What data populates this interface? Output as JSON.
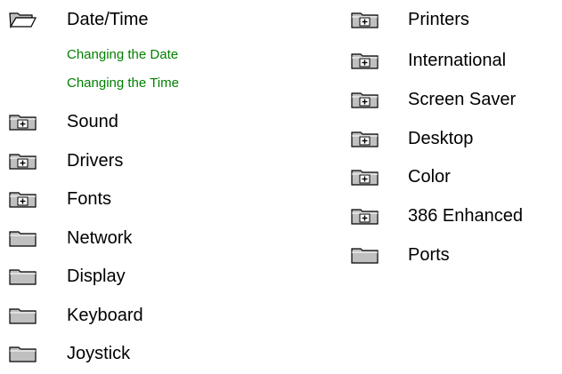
{
  "left_column": {
    "items": [
      {
        "label": "Date/Time",
        "icon": "open-folder-icon"
      },
      {
        "label": "Sound",
        "icon": "folder-plus-icon"
      },
      {
        "label": "Drivers",
        "icon": "folder-plus-icon"
      },
      {
        "label": "Fonts",
        "icon": "folder-plus-icon"
      },
      {
        "label": "Network",
        "icon": "folder-icon"
      },
      {
        "label": "Display",
        "icon": "folder-icon"
      },
      {
        "label": "Keyboard",
        "icon": "folder-icon"
      },
      {
        "label": "Joystick",
        "icon": "folder-icon"
      }
    ],
    "sub_items": [
      {
        "label": "Changing the Date"
      },
      {
        "label": "Changing the Time"
      }
    ]
  },
  "right_column": {
    "items": [
      {
        "label": "Printers",
        "icon": "folder-plus-icon"
      },
      {
        "label": "International",
        "icon": "folder-plus-icon"
      },
      {
        "label": "Screen Saver",
        "icon": "folder-plus-icon"
      },
      {
        "label": "Desktop",
        "icon": "folder-plus-icon"
      },
      {
        "label": "Color",
        "icon": "folder-plus-icon"
      },
      {
        "label": "386 Enhanced",
        "icon": "folder-plus-icon"
      },
      {
        "label": "Ports",
        "icon": "folder-icon"
      }
    ]
  },
  "colors": {
    "link_green": "#008000",
    "text": "#000000",
    "background": "#ffffff"
  }
}
